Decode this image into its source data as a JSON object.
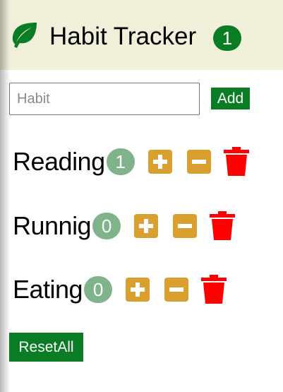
{
  "header": {
    "title": "Habit Tracker",
    "badge_count": "1",
    "logo_icon": "leaf-icon"
  },
  "form": {
    "placeholder": "Habit",
    "value": "",
    "add_label": "Add"
  },
  "habits": [
    {
      "name": "Reading",
      "count": "1"
    },
    {
      "name": "Runnig",
      "count": "0"
    },
    {
      "name": "Eating",
      "count": "0"
    }
  ],
  "icons": {
    "increment": "plus-square-icon",
    "decrement": "minus-square-icon",
    "delete": "trash-icon"
  },
  "reset_label": "ResetAll",
  "colors": {
    "header_bg": "#efefda",
    "primary_green": "#0a7d24",
    "muted_green_badge": "#7fb38a",
    "amber_button": "#d9a030",
    "delete_red": "#ff0000"
  }
}
